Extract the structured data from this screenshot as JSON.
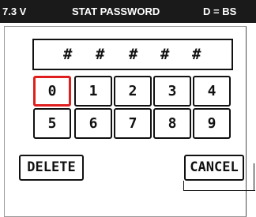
{
  "status_bar": {
    "voltage": "7.3 V",
    "title": "STAT PASSWORD",
    "mode": "D = BS"
  },
  "password": {
    "mask_chars": [
      "#",
      "#",
      "#",
      "#",
      "#"
    ]
  },
  "keypad": {
    "row1": [
      "0",
      "1",
      "2",
      "3",
      "4"
    ],
    "row2": [
      "5",
      "6",
      "7",
      "8",
      "9"
    ],
    "selected_key": "0"
  },
  "actions": {
    "delete_label": "DELETE",
    "cancel_label": "CANCEL"
  },
  "colors": {
    "status_bar_bg": "#1a1a1a",
    "selection_border": "#e01e1e"
  }
}
